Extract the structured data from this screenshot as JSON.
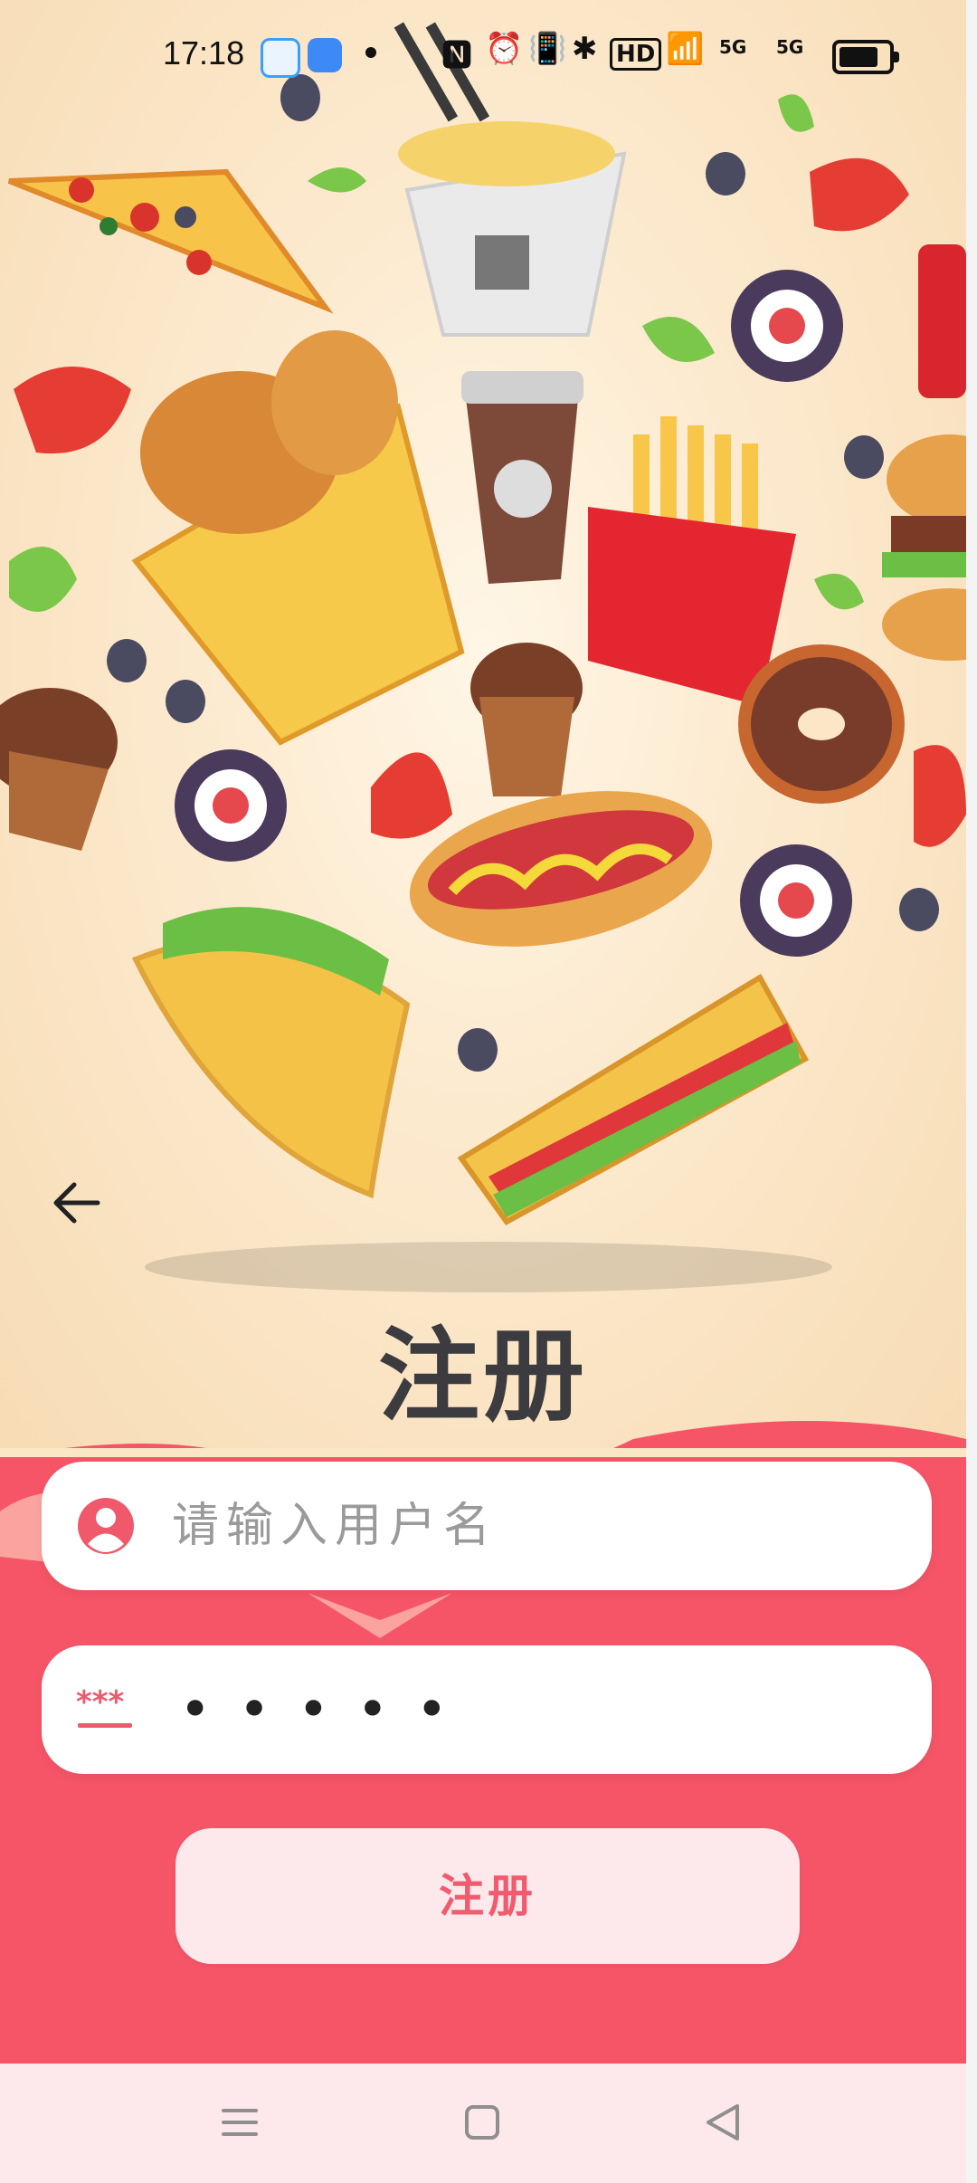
{
  "status_bar": {
    "time": "17:18",
    "network_label_1": "5G",
    "network_label_2": "5G",
    "hd_label": "HD"
  },
  "page": {
    "title": "注册",
    "back_icon": "arrow-left-icon"
  },
  "form": {
    "username": {
      "placeholder": "请输入用户名",
      "value": "",
      "icon": "user-circle-icon"
    },
    "password": {
      "value": "•••••",
      "icon": "password-asterisk-icon"
    },
    "submit_label": "注册"
  },
  "nav_bar": {
    "menu_icon": "menu-icon",
    "home_icon": "home-square-icon",
    "back_icon": "triangle-back-icon"
  },
  "colors": {
    "accent": "#f55567",
    "button_bg": "#fde9ec",
    "button_text": "#f15b6e",
    "title": "#3c3c40",
    "background": "#fbe6c6"
  }
}
